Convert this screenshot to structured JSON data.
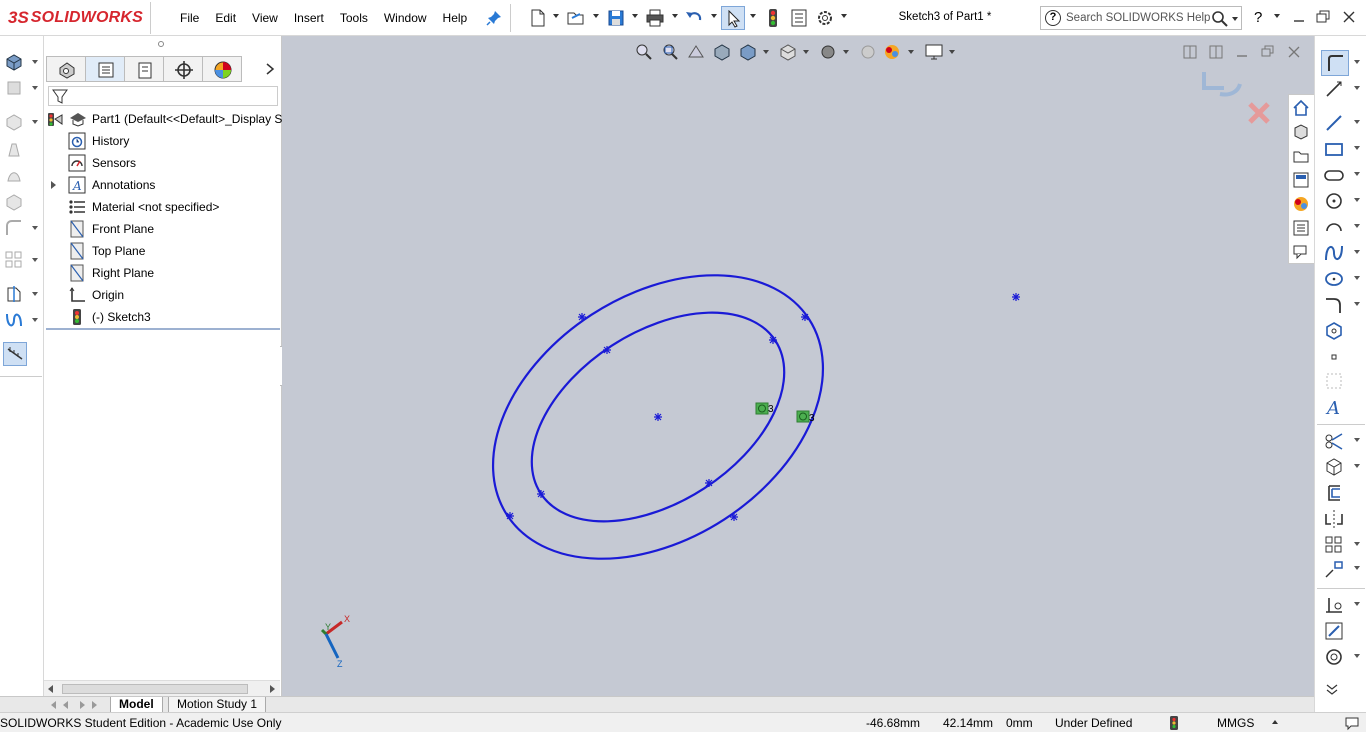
{
  "app": {
    "logo_ds": "3S",
    "logo_name": "SOLIDWORKS",
    "document_title": "Sketch3 of Part1 *"
  },
  "menu": [
    "File",
    "Edit",
    "View",
    "Insert",
    "Tools",
    "Window",
    "Help"
  ],
  "search": {
    "placeholder": "Search SOLIDWORKS Help"
  },
  "help_label": "?",
  "feature_tree": {
    "root": "Part1  (Default<<Default>_Display S",
    "items": [
      {
        "label": "History",
        "icon": "history-icon",
        "expandable": false
      },
      {
        "label": "Sensors",
        "icon": "sensors-icon",
        "expandable": false
      },
      {
        "label": "Annotations",
        "icon": "annotations-icon",
        "expandable": true
      },
      {
        "label": "Material <not specified>",
        "icon": "material-icon",
        "expandable": false
      },
      {
        "label": "Front Plane",
        "icon": "plane-icon",
        "expandable": false
      },
      {
        "label": "Top Plane",
        "icon": "plane-icon",
        "expandable": false
      },
      {
        "label": "Right Plane",
        "icon": "plane-icon",
        "expandable": false
      },
      {
        "label": "Origin",
        "icon": "origin-icon",
        "expandable": false
      },
      {
        "label": "(-) Sketch3",
        "icon": "sketch-icon",
        "expandable": false
      }
    ],
    "tab_icons": [
      "feature-manager-icon",
      "property-manager-icon",
      "configuration-manager-icon",
      "dimxpert-icon",
      "display-manager-icon"
    ]
  },
  "viewport": {
    "background": "#c5c9d3",
    "sketch_color": "#1a1ad6",
    "relation_label_1": "3",
    "relation_label_2": "3",
    "triad_x": "X",
    "triad_y": "Y",
    "triad_z": "Z"
  },
  "bottom_tabs": [
    "Model",
    "Motion Study 1"
  ],
  "status": {
    "edition": "SOLIDWORKS Student Edition - Academic Use Only",
    "x": "-46.68mm",
    "y": "42.14mm",
    "z": "0mm",
    "state": "Under Defined",
    "units": "MMGS"
  },
  "colors": {
    "brand": "#d6262e",
    "accent": "#2a7ad5"
  }
}
